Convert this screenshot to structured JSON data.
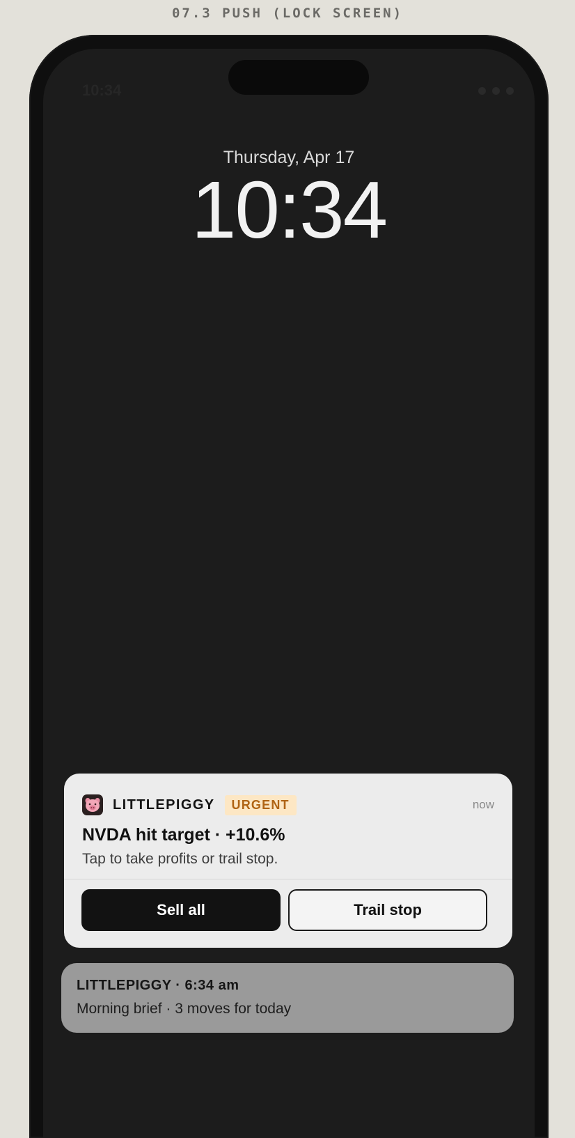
{
  "section_label": "07.3 PUSH (LOCK SCREEN)",
  "status_bar": {
    "time": "10:34",
    "dots": [
      "dot",
      "dot",
      "dot"
    ]
  },
  "lock_screen": {
    "date": "Thursday, Apr 17",
    "time": "10:34"
  },
  "notification": {
    "app_icon": "pig-face-icon",
    "app_name": "LITTLEPIGGY",
    "badge": "URGENT",
    "timestamp": "now",
    "title": "NVDA hit target · +10.6%",
    "body": "Tap to take profits or trail stop.",
    "actions": {
      "primary": "Sell all",
      "secondary": "Trail stop"
    }
  },
  "earlier_notification": {
    "title": "LITTLEPIGGY · 6:34 am",
    "body": "Morning brief · 3 moves for today"
  },
  "colors": {
    "background": "#e3e1da",
    "screen": "#1c1c1c",
    "badge_bg": "#fde7c4",
    "badge_text": "#b06414",
    "primary_button": "#121212"
  }
}
